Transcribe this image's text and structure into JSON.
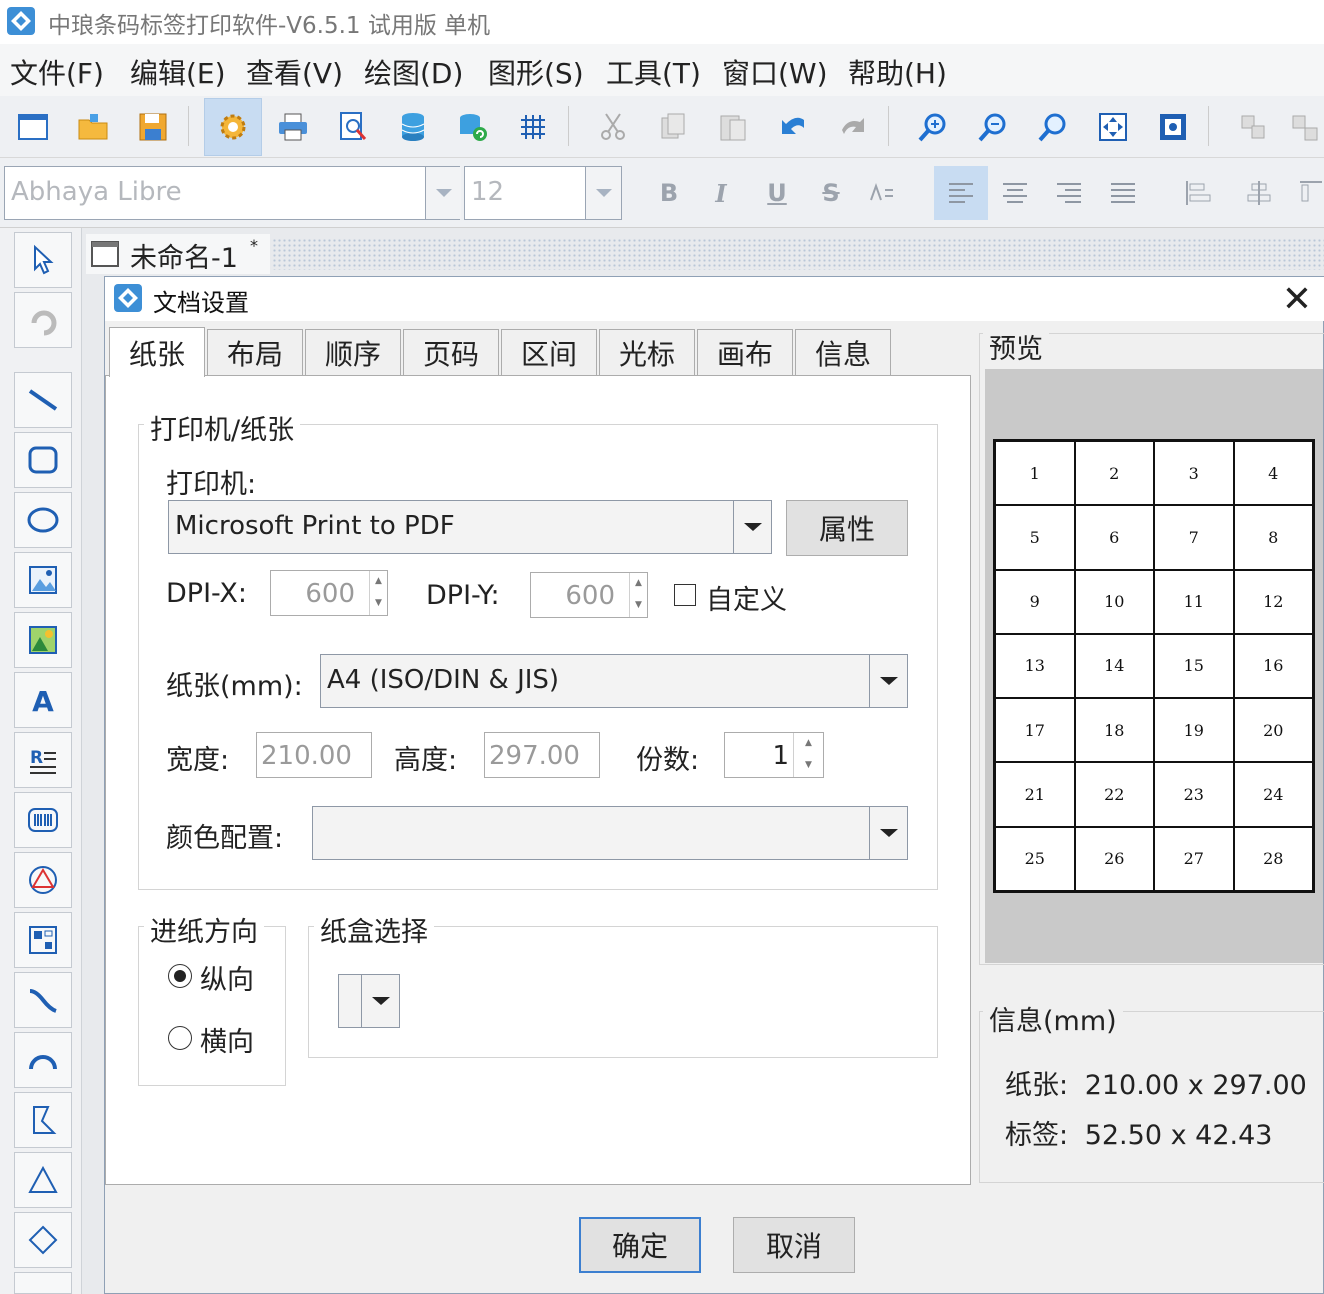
{
  "app": {
    "title": "中琅条码标签打印软件-V6.5.1 试用版 单机"
  },
  "menu": [
    "文件(F)",
    "编辑(E)",
    "查看(V)",
    "绘图(D)",
    "图形(S)",
    "工具(T)",
    "窗口(W)",
    "帮助(H)"
  ],
  "font_bar": {
    "font_name": "Abhaya Libre",
    "font_size": "12",
    "bold": "B",
    "italic": "I",
    "underline": "U",
    "strike": "S"
  },
  "document": {
    "tab_title": "未命名-1",
    "modified_mark": "*"
  },
  "dialog": {
    "title": "文档设置",
    "close": "✕",
    "tabs": [
      "纸张",
      "布局",
      "顺序",
      "页码",
      "区间",
      "光标",
      "画布",
      "信息"
    ],
    "active_tab": "纸张",
    "printer_group": {
      "title": "打印机/纸张",
      "printer_label": "打印机:",
      "printer_value": "Microsoft Print to PDF",
      "properties_button": "属性",
      "dpi_x_label": "DPI-X:",
      "dpi_x_value": "600",
      "dpi_y_label": "DPI-Y:",
      "dpi_y_value": "600",
      "custom_label": "自定义",
      "custom_checked": false,
      "paper_label": "纸张(mm):",
      "paper_value": "A4 (ISO/DIN & JIS)",
      "width_label": "宽度:",
      "width_value": "210.00",
      "height_label": "高度:",
      "height_value": "297.00",
      "copies_label": "份数:",
      "copies_value": "1",
      "color_label": "颜色配置:",
      "color_value": ""
    },
    "feed_group": {
      "title": "进纸方向",
      "portrait": "纵向",
      "landscape": "横向",
      "selected": "纵向"
    },
    "tray_group": {
      "title": "纸盒选择",
      "value": ""
    },
    "preview": {
      "title": "预览",
      "cells": [
        "1",
        "2",
        "3",
        "4",
        "5",
        "6",
        "7",
        "8",
        "9",
        "10",
        "11",
        "12",
        "13",
        "14",
        "15",
        "16",
        "17",
        "18",
        "19",
        "20",
        "21",
        "22",
        "23",
        "24",
        "25",
        "26",
        "27",
        "28"
      ]
    },
    "info": {
      "title": "信息(mm)",
      "paper_label": "纸张:",
      "paper_size": "210.00 x 297.00",
      "label_label": "标签:",
      "label_size": "52.50 x 42.43"
    },
    "ok_button": "确定",
    "cancel_button": "取消"
  },
  "colors": {
    "accent": "#c8dcf2",
    "border": "#acacac",
    "preview_bg": "#c9c9c9"
  }
}
